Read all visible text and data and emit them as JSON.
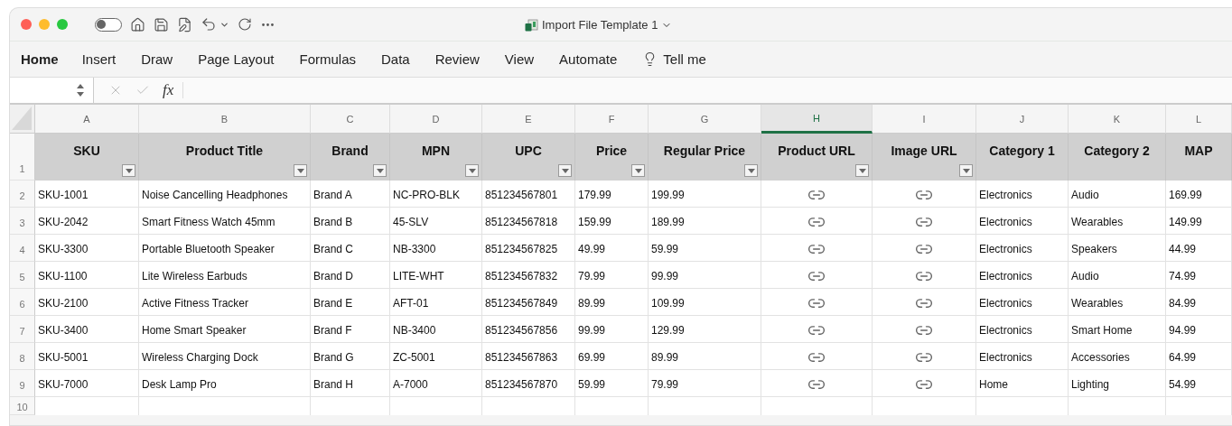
{
  "window": {
    "title": "Import File Template 1",
    "autosave_on": false
  },
  "ribbon": {
    "tabs": [
      {
        "label": "Home",
        "selected": true
      },
      {
        "label": "Insert",
        "selected": false
      },
      {
        "label": "Draw",
        "selected": false
      },
      {
        "label": "Page Layout",
        "selected": false
      },
      {
        "label": "Formulas",
        "selected": false
      },
      {
        "label": "Data",
        "selected": false
      },
      {
        "label": "Review",
        "selected": false
      },
      {
        "label": "View",
        "selected": false
      },
      {
        "label": "Automate",
        "selected": false
      }
    ],
    "tell_me": "Tell me"
  },
  "formula_bar": {
    "function_label": "fx"
  },
  "sheet": {
    "columns": [
      {
        "letter": "A",
        "heading": "SKU",
        "selected": false,
        "filter": true,
        "kind": "text"
      },
      {
        "letter": "B",
        "heading": "Product Title",
        "selected": false,
        "filter": true,
        "kind": "text"
      },
      {
        "letter": "C",
        "heading": "Brand",
        "selected": false,
        "filter": true,
        "kind": "text"
      },
      {
        "letter": "D",
        "heading": "MPN",
        "selected": false,
        "filter": true,
        "kind": "text"
      },
      {
        "letter": "E",
        "heading": "UPC",
        "selected": false,
        "filter": true,
        "kind": "text"
      },
      {
        "letter": "F",
        "heading": "Price",
        "selected": false,
        "filter": true,
        "kind": "text"
      },
      {
        "letter": "G",
        "heading": "Regular Price",
        "selected": false,
        "filter": true,
        "kind": "text"
      },
      {
        "letter": "H",
        "heading": "Product URL",
        "selected": true,
        "filter": true,
        "kind": "link"
      },
      {
        "letter": "I",
        "heading": "Image URL",
        "selected": false,
        "filter": true,
        "kind": "link"
      },
      {
        "letter": "J",
        "heading": "Category 1",
        "selected": false,
        "filter": false,
        "kind": "text"
      },
      {
        "letter": "K",
        "heading": "Category 2",
        "selected": false,
        "filter": false,
        "kind": "text"
      },
      {
        "letter": "L",
        "heading": "MAP",
        "selected": false,
        "filter": false,
        "kind": "text"
      }
    ],
    "header_row_number": "1",
    "rows": [
      {
        "number": "2",
        "cells": [
          "SKU-1001",
          "Noise Cancelling Headphones",
          "Brand A",
          "NC-PRO-BLK",
          "851234567801",
          "179.99",
          "199.99",
          null,
          null,
          "Electronics",
          "Audio",
          "169.99"
        ]
      },
      {
        "number": "3",
        "cells": [
          "SKU-2042",
          "Smart Fitness Watch 45mm",
          "Brand B",
          "45-SLV",
          "851234567818",
          "159.99",
          "189.99",
          null,
          null,
          "Electronics",
          "Wearables",
          "149.99"
        ]
      },
      {
        "number": "4",
        "cells": [
          "SKU-3300",
          "Portable Bluetooth Speaker",
          "Brand C",
          "NB-3300",
          "851234567825",
          "49.99",
          "59.99",
          null,
          null,
          "Electronics",
          "Speakers",
          "44.99"
        ]
      },
      {
        "number": "5",
        "cells": [
          "SKU-1100",
          "Lite Wireless Earbuds",
          "Brand D",
          "LITE-WHT",
          "851234567832",
          "79.99",
          "99.99",
          null,
          null,
          "Electronics",
          "Audio",
          "74.99"
        ]
      },
      {
        "number": "6",
        "cells": [
          "SKU-2100",
          "Active Fitness Tracker",
          "Brand E",
          "AFT-01",
          "851234567849",
          "89.99",
          "109.99",
          null,
          null,
          "Electronics",
          "Wearables",
          "84.99"
        ]
      },
      {
        "number": "7",
        "cells": [
          "SKU-3400",
          "Home Smart Speaker",
          "Brand F",
          "NB-3400",
          "851234567856",
          "99.99",
          "129.99",
          null,
          null,
          "Electronics",
          "Smart Home",
          "94.99"
        ]
      },
      {
        "number": "8",
        "cells": [
          "SKU-5001",
          "Wireless Charging Dock",
          "Brand G",
          "ZC-5001",
          "851234567863",
          "69.99",
          "89.99",
          null,
          null,
          "Electronics",
          "Accessories",
          "64.99"
        ]
      },
      {
        "number": "9",
        "cells": [
          "SKU-7000",
          "Desk Lamp Pro",
          "Brand H",
          "A-7000",
          "851234567870",
          "59.99",
          "79.99",
          null,
          null,
          "Home",
          "Lighting",
          "54.99"
        ]
      },
      {
        "number": "10",
        "cells": [
          null,
          null,
          null,
          null,
          null,
          null,
          null,
          null,
          null,
          null,
          null,
          null
        ]
      }
    ]
  }
}
